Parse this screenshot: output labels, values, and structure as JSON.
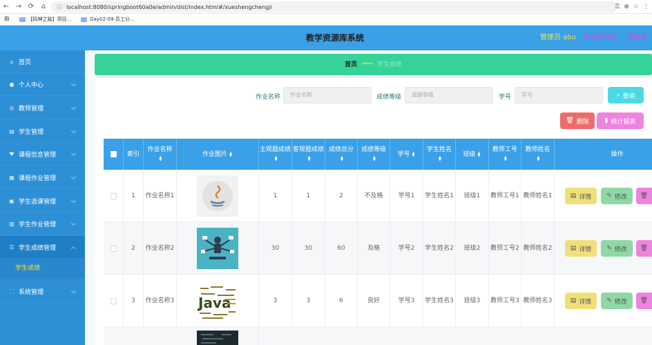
{
  "browser": {
    "url": "localhost:8080/springboot60a0e/admin/dist/index.html#/xueshengchengji",
    "bookmarks": [
      "【码神之路】项目...",
      "Day02-09-员工分..."
    ]
  },
  "header": {
    "title": "教学资源库系统",
    "user": "管理员 abo",
    "link_frontend": "退出到前台",
    "link_logout": "退出登录"
  },
  "sidebar": {
    "items": [
      {
        "label": "首页",
        "icon": "home-icon"
      },
      {
        "label": "个人中心",
        "icon": "user-icon"
      },
      {
        "label": "教师管理",
        "icon": "teacher-icon"
      },
      {
        "label": "学生管理",
        "icon": "student-icon"
      },
      {
        "label": "课程信息管理",
        "icon": "course-icon"
      },
      {
        "label": "课程作业管理",
        "icon": "homework-icon"
      },
      {
        "label": "学生选课管理",
        "icon": "course-select-icon"
      },
      {
        "label": "学生作业管理",
        "icon": "student-homework-icon"
      },
      {
        "label": "学生成绩管理",
        "icon": "score-icon"
      },
      {
        "label": "系统管理",
        "icon": "system-icon"
      }
    ],
    "active_sub": "学生成绩"
  },
  "breadcrumb": {
    "home": "首页",
    "separator": "*****",
    "current": "学生成绩"
  },
  "search": {
    "name_label": "作业名称",
    "name_placeholder": "作业名称",
    "grade_label": "成绩等级",
    "grade_placeholder": "成绩等级",
    "id_label": "学号",
    "id_placeholder": "学号",
    "search_button": "查询"
  },
  "toolbar": {
    "delete_button": "删除",
    "stats_button": "统计报表"
  },
  "table": {
    "headers": [
      "索引",
      "作业名称",
      "作业图片",
      "主观题成绩",
      "客观题成绩",
      "成绩总分",
      "成绩等级",
      "学号",
      "学生姓名",
      "班级",
      "教师工号",
      "教师姓名",
      "操作"
    ],
    "rows": [
      {
        "index": "1",
        "name": "作业名称1",
        "subjective": "1",
        "objective": "1",
        "total": "2",
        "level": "不及格",
        "student_id": "学号1",
        "student_name": "学生姓名1",
        "class": "班级1",
        "teacher_id": "教师工号1",
        "teacher_name": "教师姓名1",
        "image": "java-logo-image"
      },
      {
        "index": "2",
        "name": "作业名称2",
        "subjective": "30",
        "objective": "30",
        "total": "60",
        "level": "及格",
        "student_id": "学号2",
        "student_name": "学生姓名2",
        "class": "班级2",
        "teacher_id": "教师工号2",
        "teacher_name": "教师姓名2",
        "image": "multitasking-figure-image"
      },
      {
        "index": "3",
        "name": "作业名称3",
        "subjective": "3",
        "objective": "3",
        "total": "6",
        "level": "良好",
        "student_id": "学号3",
        "student_name": "学生姓名3",
        "class": "班级3",
        "teacher_id": "教师工号3",
        "teacher_name": "教师姓名3",
        "image": "java-word-cloud-image"
      }
    ],
    "actions": {
      "detail": "详情",
      "edit": "修改",
      "delete": "删除"
    }
  },
  "colors": {
    "header_bg": "#3aa0e8",
    "sidebar_bg": "#2d8fd6",
    "breadcrumb_bg": "#35d39a",
    "user_text": "#f1e04b",
    "link_text": "#d54bd8"
  }
}
